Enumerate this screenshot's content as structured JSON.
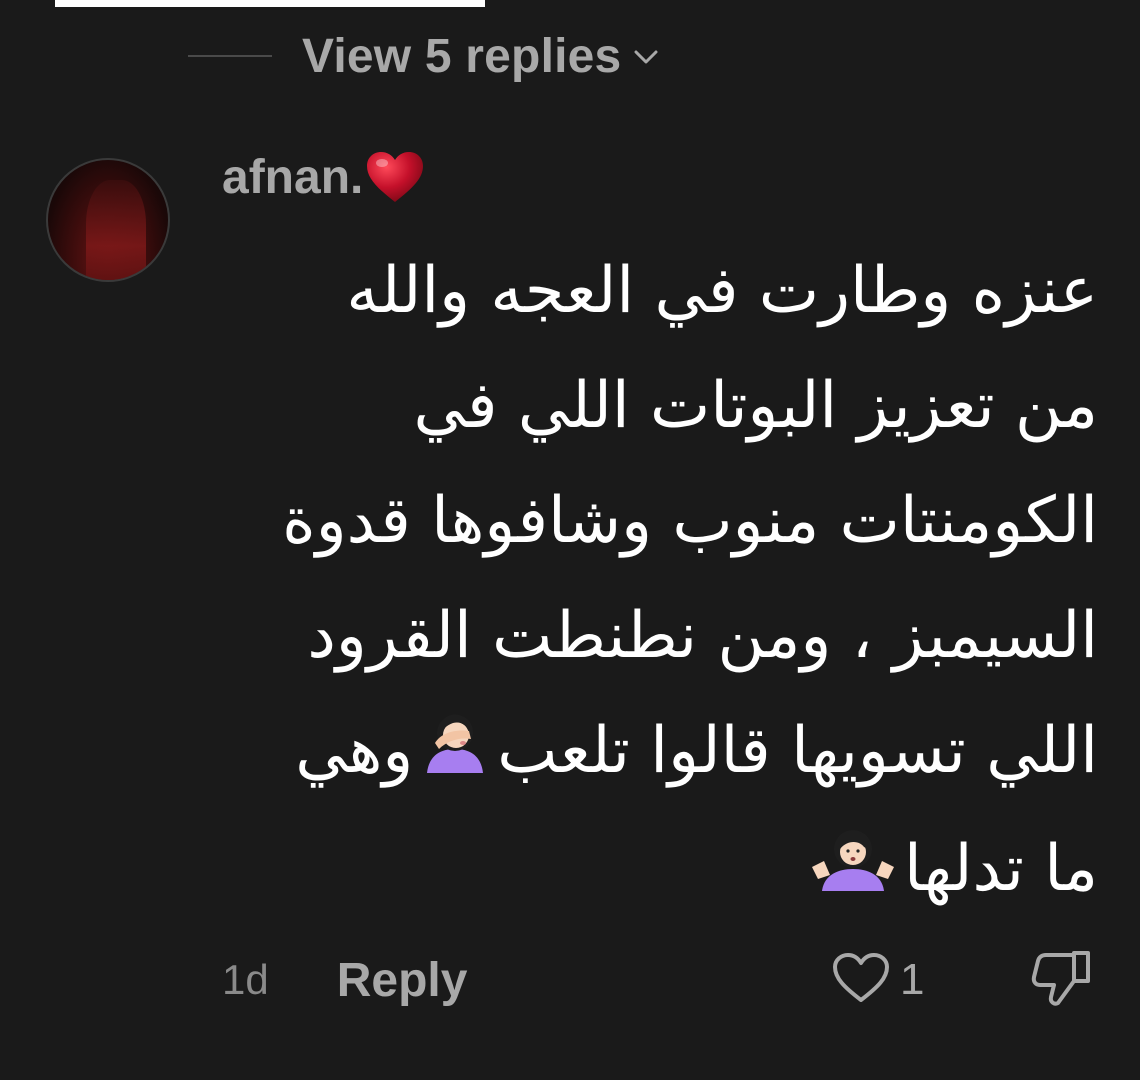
{
  "thread": {
    "view_replies_label": "View 5 replies"
  },
  "comment": {
    "username": "afnan.",
    "line1": "عنزه وطارت في العجه والله",
    "line2": "من تعزيز البوتات اللي في",
    "line3": "الكومنتات منوب وشافوها قدوة",
    "line4": "السيمبز ، ومن نطنطت القرود",
    "line5_before_emoji": "اللي تسويها قالوا تلعب",
    "line5_after_emoji": "وهي",
    "line6": "ما تدلها",
    "time": "1d",
    "reply_label": "Reply",
    "like_count": "1"
  },
  "icons": {
    "chevron": "chevron-down-icon",
    "heart_emoji": "red-heart-emoji",
    "facepalm_emoji": "woman-facepalming-emoji",
    "shrug_emoji": "woman-shrugging-emoji",
    "like": "heart-outline-icon",
    "dislike": "thumbs-down-icon"
  },
  "colors": {
    "background": "#1a1a1a",
    "muted_text": "#a8a8a8",
    "primary_text": "#ffffff",
    "heart_red": "#c4102a"
  }
}
